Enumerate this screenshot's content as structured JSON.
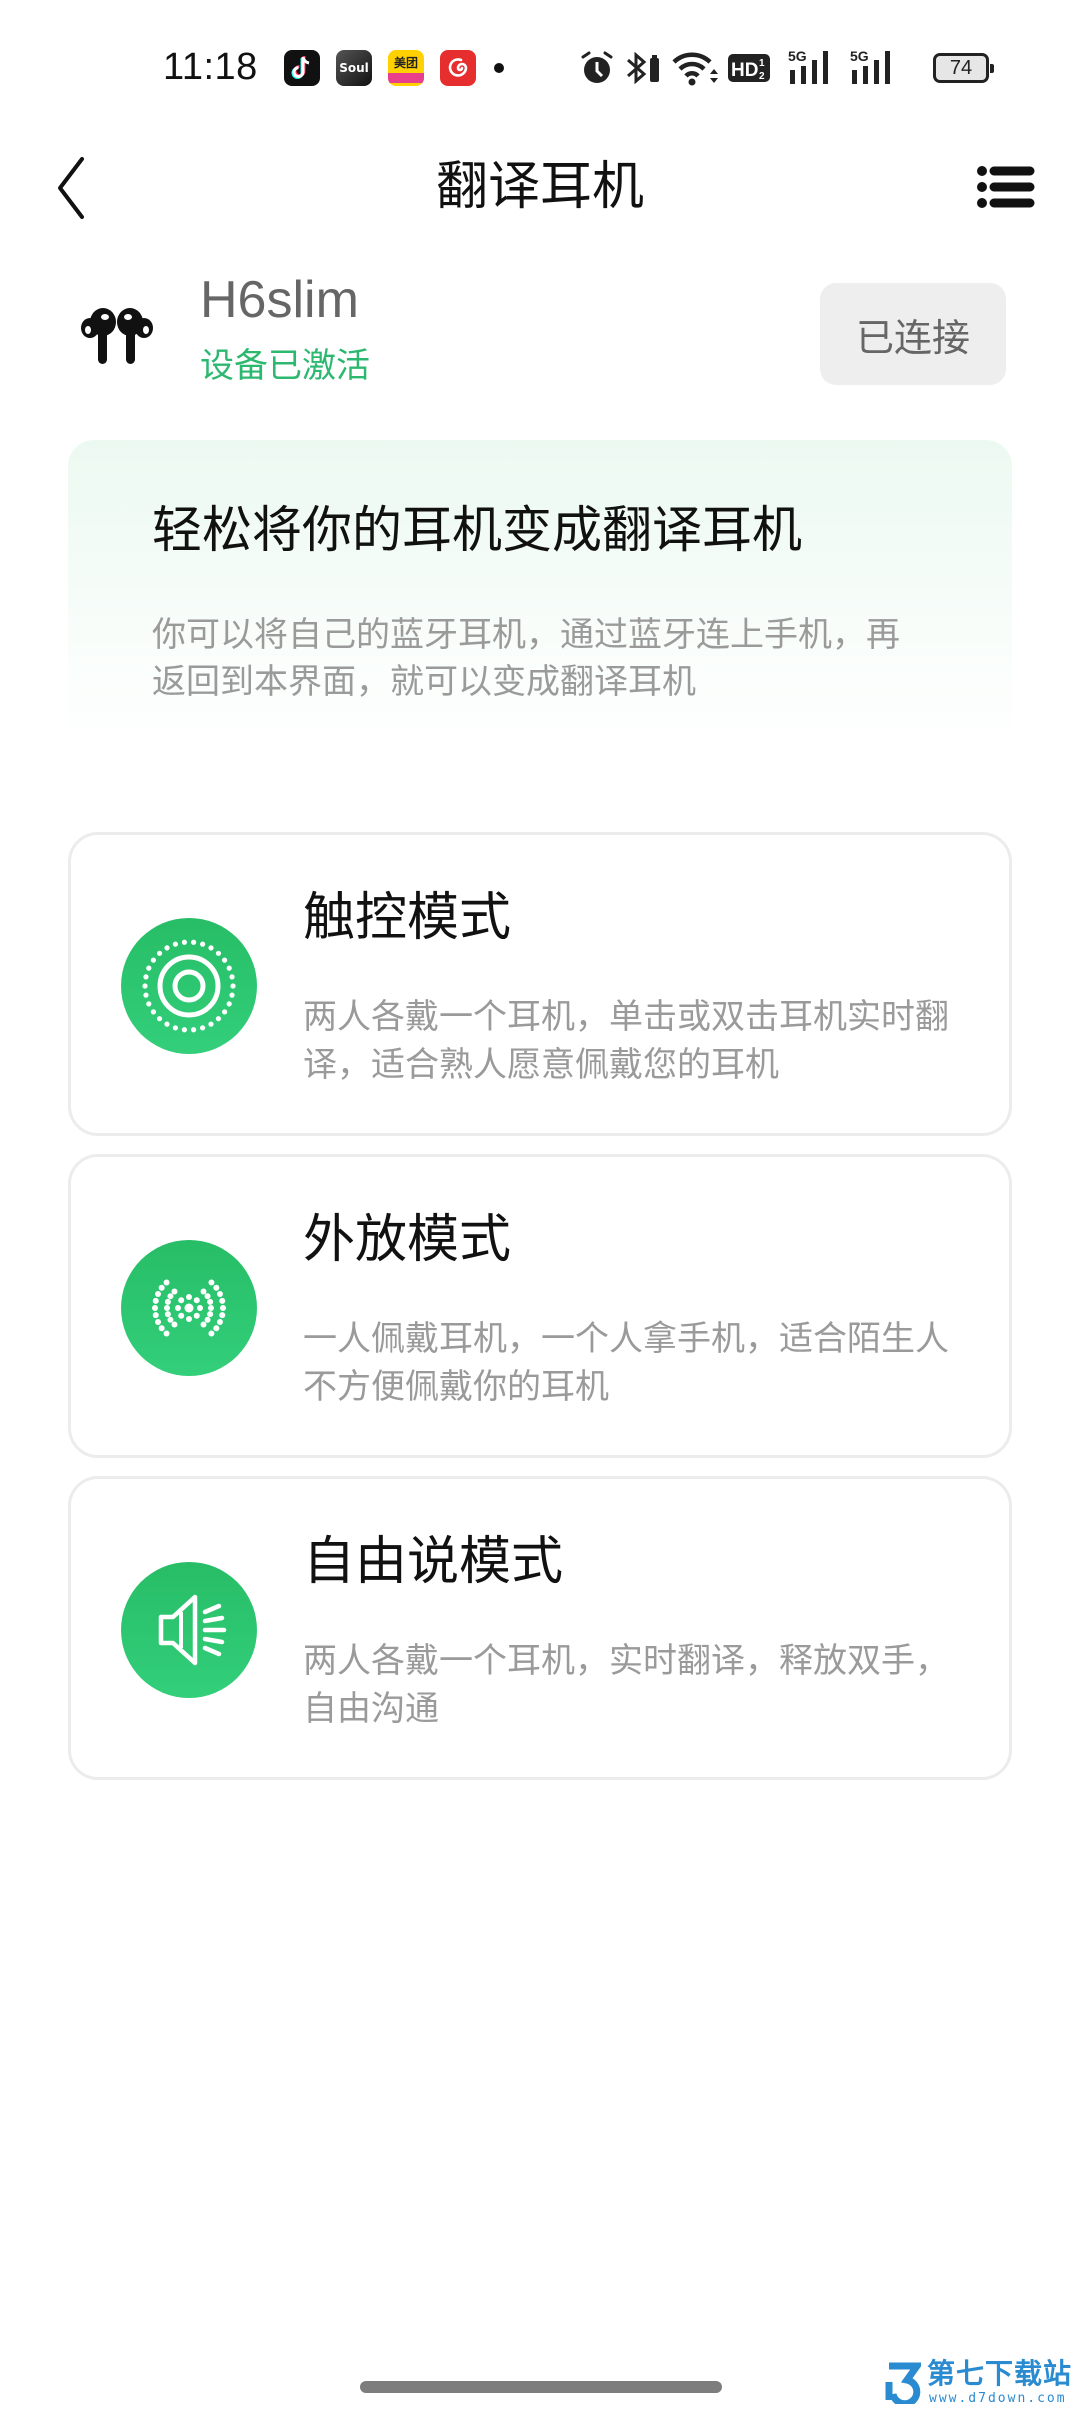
{
  "status_bar": {
    "time": "11:18",
    "notification_apps": [
      {
        "name": "douyin",
        "glyph": "♪"
      },
      {
        "name": "soul",
        "glyph": "Soul"
      },
      {
        "name": "meituan",
        "glyph": "美团"
      },
      {
        "name": "netease-music",
        "glyph": "6"
      }
    ],
    "system_icons": [
      "alarm-icon",
      "bluetooth-icon",
      "wifi-icon",
      "hd-volte-icon",
      "signal-5g-sim1-icon",
      "signal-5g-sim2-icon"
    ],
    "hd_label": "HD",
    "network_label_1": "5G",
    "network_label_2": "5G",
    "battery_level": "74"
  },
  "header": {
    "title": "翻译耳机",
    "back_icon": "chevron-left-icon",
    "menu_icon": "list-menu-icon"
  },
  "device": {
    "name": "H6slim",
    "status": "设备已激活",
    "connect_button": "已连接",
    "status_color": "#2db870"
  },
  "banner": {
    "title": "轻松将你的耳机变成翻译耳机",
    "description": "你可以将自己的蓝牙耳机，通过蓝牙连上手机，再返回到本界面，就可以变成翻译耳机"
  },
  "modes": [
    {
      "icon": "touch-target-icon",
      "title": "触控模式",
      "description": "两人各戴一个耳机，单击或双击耳机实时翻译，适合熟人愿意佩戴您的耳机"
    },
    {
      "icon": "broadcast-icon",
      "title": "外放模式",
      "description": "一人佩戴耳机，一个人拿手机，适合陌生人不方便佩戴你的耳机"
    },
    {
      "icon": "speaker-icon",
      "title": "自由说模式",
      "description": "两人各戴一个耳机，实时翻译，释放双手，自由沟通"
    }
  ],
  "accent_color": "#2cc56f",
  "watermark": {
    "name": "第七下载站",
    "url": "www.d7down.com"
  }
}
